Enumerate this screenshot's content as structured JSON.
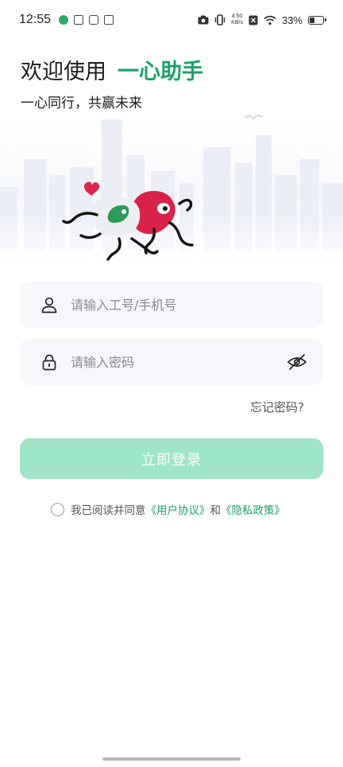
{
  "status_bar": {
    "time": "12:55",
    "net_speed_value": "4.50",
    "net_speed_unit": "KB/s",
    "battery_percent": "33%",
    "battery_level": 0.33
  },
  "header": {
    "welcome_prefix": "欢迎使用",
    "brand_name": "一心助手",
    "slogan": "一心同行，共赢未来"
  },
  "login_form": {
    "username_placeholder": "请输入工号/手机号",
    "password_placeholder": "请输入密码",
    "forgot_password": "忘记密码?",
    "login_button": "立即登录"
  },
  "agreement": {
    "prefix": "我已阅读并同意",
    "user_agreement": "《用户协议》",
    "conjunction": "和",
    "privacy_policy": "《隐私政策》"
  },
  "colors": {
    "brand_green": "#1aa366",
    "login_button_disabled": "#9ee4c6",
    "input_background": "#f5f7fb",
    "mascot_red": "#d8244a",
    "mascot_green": "#2e9a58"
  },
  "icons": {
    "username_field": "user-icon",
    "password_field": "lock-icon",
    "password_toggle": "eye-off-icon"
  }
}
